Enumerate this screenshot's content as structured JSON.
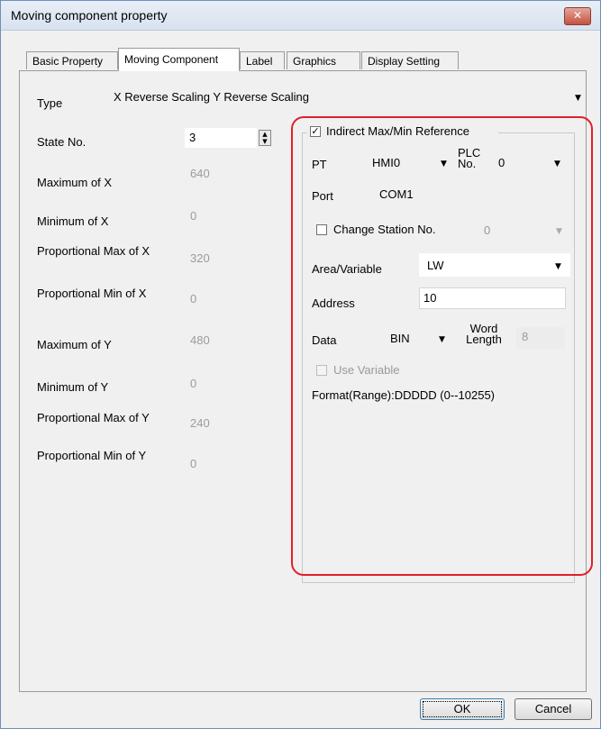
{
  "window": {
    "title": "Moving component property",
    "close_icon": "close-icon"
  },
  "tabs": [
    {
      "label": "Basic Property"
    },
    {
      "label": "Moving Component"
    },
    {
      "label": "Label"
    },
    {
      "label": "Graphics"
    },
    {
      "label": "Display Setting"
    }
  ],
  "type_row": {
    "label": "Type",
    "value": "X Reverse Scaling Y Reverse Scaling"
  },
  "state_no": {
    "label": "State No.",
    "value": "3"
  },
  "props": [
    {
      "label": "Maximum of X",
      "value": "640"
    },
    {
      "label": "Minimum of X",
      "value": "0"
    },
    {
      "label": "Proportional Max of X",
      "value": "320"
    },
    {
      "label": "Proportional Min of X",
      "value": "0"
    },
    {
      "label": "Maximum of Y",
      "value": "480"
    },
    {
      "label": "Minimum of Y",
      "value": "0"
    },
    {
      "label": "Proportional Max of Y",
      "value": "240"
    },
    {
      "label": "Proportional Min of Y",
      "value": "0"
    }
  ],
  "indirect": {
    "checkbox_label": "Indirect Max/Min Reference",
    "checked": true,
    "pt_label": "PT",
    "pt_value": "HMI0",
    "plc_label": "PLC No.",
    "plc_value": "0",
    "port_label": "Port",
    "port_value": "COM1",
    "change_station_label": "Change Station No.",
    "change_station_value": "0",
    "area_label": "Area/Variable",
    "area_value": "LW",
    "address_label": "Address",
    "address_value": "10",
    "data_label": "Data",
    "data_value": "BIN",
    "word_length_label": "Word Length",
    "word_length_value": "8",
    "use_variable_label": "Use Variable",
    "format_text": "Format(Range):DDDDD (0--10255)"
  },
  "buttons": {
    "ok": "OK",
    "cancel": "Cancel"
  },
  "colors": {
    "highlight": "#e0202a",
    "title_bg": "#dfe7f2",
    "close": "#c7513f"
  }
}
